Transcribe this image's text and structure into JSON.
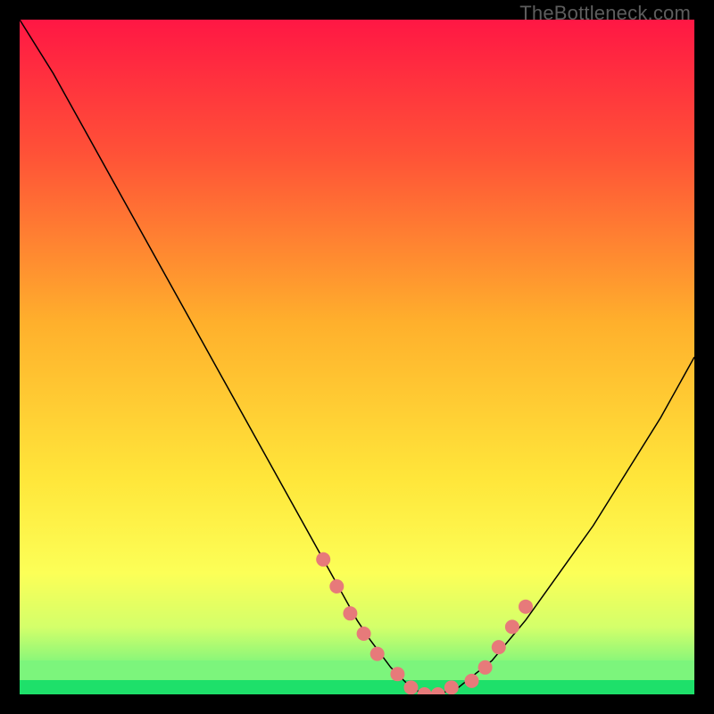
{
  "watermark": "TheBottleneck.com",
  "colors": {
    "dot": "#e77a7a",
    "curve": "#000000",
    "green_band_top": "#7cf57c",
    "green_band_bottom": "#1ee06a"
  },
  "chart_data": {
    "type": "line",
    "title": "",
    "xlabel": "",
    "ylabel": "",
    "xlim": [
      0,
      100
    ],
    "ylim": [
      0,
      100
    ],
    "grid": false,
    "legend": false,
    "series": [
      {
        "name": "bottleneck-curve",
        "x": [
          0,
          5,
          10,
          15,
          20,
          25,
          30,
          35,
          40,
          45,
          50,
          52,
          55,
          58,
          60,
          62,
          65,
          70,
          75,
          80,
          85,
          90,
          95,
          100
        ],
        "y": [
          100,
          92,
          83,
          74,
          65,
          56,
          47,
          38,
          29,
          20,
          11,
          8,
          4,
          1,
          0,
          0,
          1,
          5,
          11,
          18,
          25,
          33,
          41,
          50
        ]
      }
    ],
    "highlight_points": {
      "name": "dots-near-minimum",
      "x": [
        45,
        47,
        49,
        51,
        53,
        56,
        58,
        60,
        62,
        64,
        67,
        69,
        71,
        73,
        75
      ],
      "y": [
        20,
        16,
        12,
        9,
        6,
        3,
        1,
        0,
        0,
        1,
        2,
        4,
        7,
        10,
        13
      ]
    },
    "background_gradient": {
      "stops": [
        {
          "pos": 0.0,
          "color": "#ff1744"
        },
        {
          "pos": 0.2,
          "color": "#ff5237"
        },
        {
          "pos": 0.45,
          "color": "#ffb02c"
        },
        {
          "pos": 0.68,
          "color": "#ffe63a"
        },
        {
          "pos": 0.82,
          "color": "#fcff57"
        },
        {
          "pos": 0.9,
          "color": "#d4ff6a"
        },
        {
          "pos": 0.96,
          "color": "#7cf57c"
        },
        {
          "pos": 1.0,
          "color": "#1ee06a"
        }
      ]
    }
  }
}
